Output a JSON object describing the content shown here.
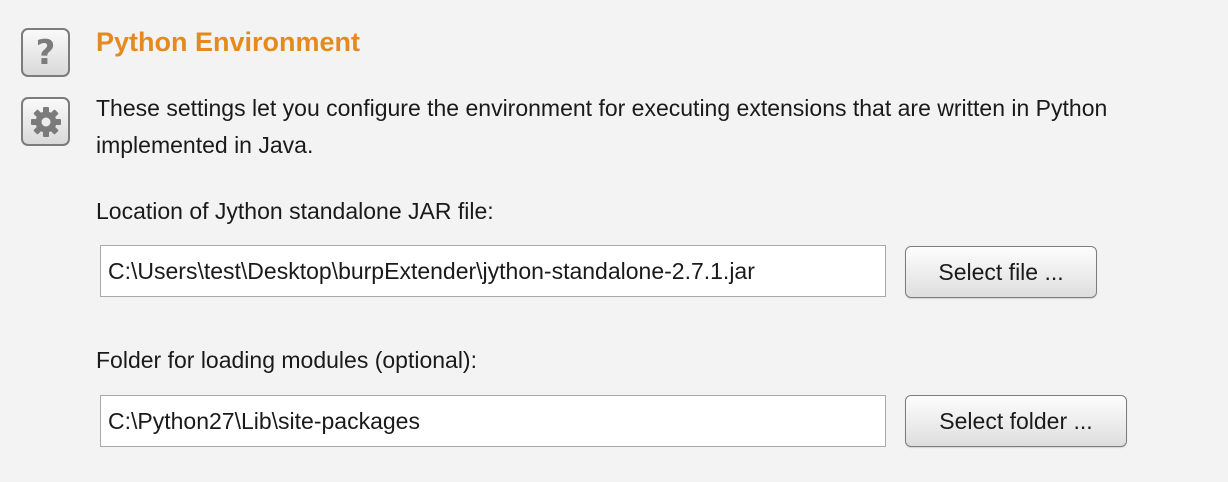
{
  "sidebar": {
    "help_icon": "question-mark-icon",
    "help_glyph": "?",
    "settings_icon": "gear-icon"
  },
  "section": {
    "title": "Python Environment",
    "description_line1": "These settings let you configure the environment for executing extensions that are written in Python",
    "description_line2": "implemented in Java."
  },
  "jar_location": {
    "label": "Location of Jython standalone JAR file:",
    "value": "C:\\Users\\test\\Desktop\\burpExtender\\jython-standalone-2.7.1.jar",
    "button_label": "Select file ..."
  },
  "modules_folder": {
    "label": "Folder for loading modules (optional):",
    "value": "C:\\Python27\\Lib\\site-packages",
    "button_label": "Select folder ..."
  },
  "colors": {
    "title": "#e58a1f",
    "background": "#f3f3f3",
    "icon_gray": "#7b7b7b"
  }
}
